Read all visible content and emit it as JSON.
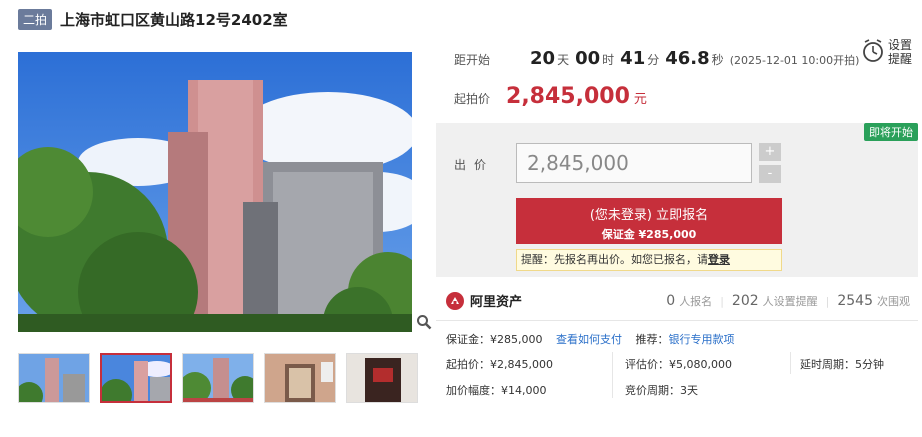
{
  "title_bar": {
    "round_badge": "二拍",
    "title": "上海市虹口区黄山路12号2402室"
  },
  "countdown": {
    "label": "距开始",
    "days": "20",
    "days_unit": "天",
    "hours": "00",
    "hours_unit": "时",
    "minutes": "41",
    "minutes_unit": "分",
    "seconds": "46.8",
    "seconds_unit": "秒",
    "note": "(2025-12-01 10:00开拍)"
  },
  "start_price": {
    "label": "起拍价",
    "value": "2,845,000",
    "unit": "元"
  },
  "reminder": {
    "line1": "设置",
    "line2": "提醒",
    "icon": "alarm-clock-icon"
  },
  "bid": {
    "status_badge": "即将开始",
    "label": "出价",
    "input_value": "2,845,000",
    "plus": "+",
    "minus": "-",
    "apply_main": "(您未登录) 立即报名",
    "apply_sub": "保证金 ¥285,000",
    "tip_prefix": "提醒：先报名再出价。如您已报名，请",
    "tip_link": "登录"
  },
  "stats": {
    "brand": "阿里资产",
    "registered_count": "0",
    "registered_label": "人报名",
    "reminders_count": "202",
    "reminders_label": "人设置提醒",
    "views_count": "2545",
    "views_label": "次围观"
  },
  "info": {
    "deposit_label": "保证金：",
    "deposit_value": "¥285,000",
    "how_to_pay": "查看如何支付",
    "recommend_label": "推荐：",
    "recommend_link": "银行专用款项",
    "start_label": "起拍价：",
    "start_value": "¥2,845,000",
    "appraisal_label": "评估价：",
    "appraisal_value": "¥5,080,000",
    "delay_label": "延时周期：",
    "delay_value": "5分钟",
    "increment_label": "加价幅度：",
    "increment_value": "¥14,000",
    "cycle_label": "竞价周期：",
    "cycle_value": "3天"
  },
  "colors": {
    "accent": "#c62f3b",
    "badge_green": "#2aa05a",
    "link": "#2a6fc9"
  }
}
